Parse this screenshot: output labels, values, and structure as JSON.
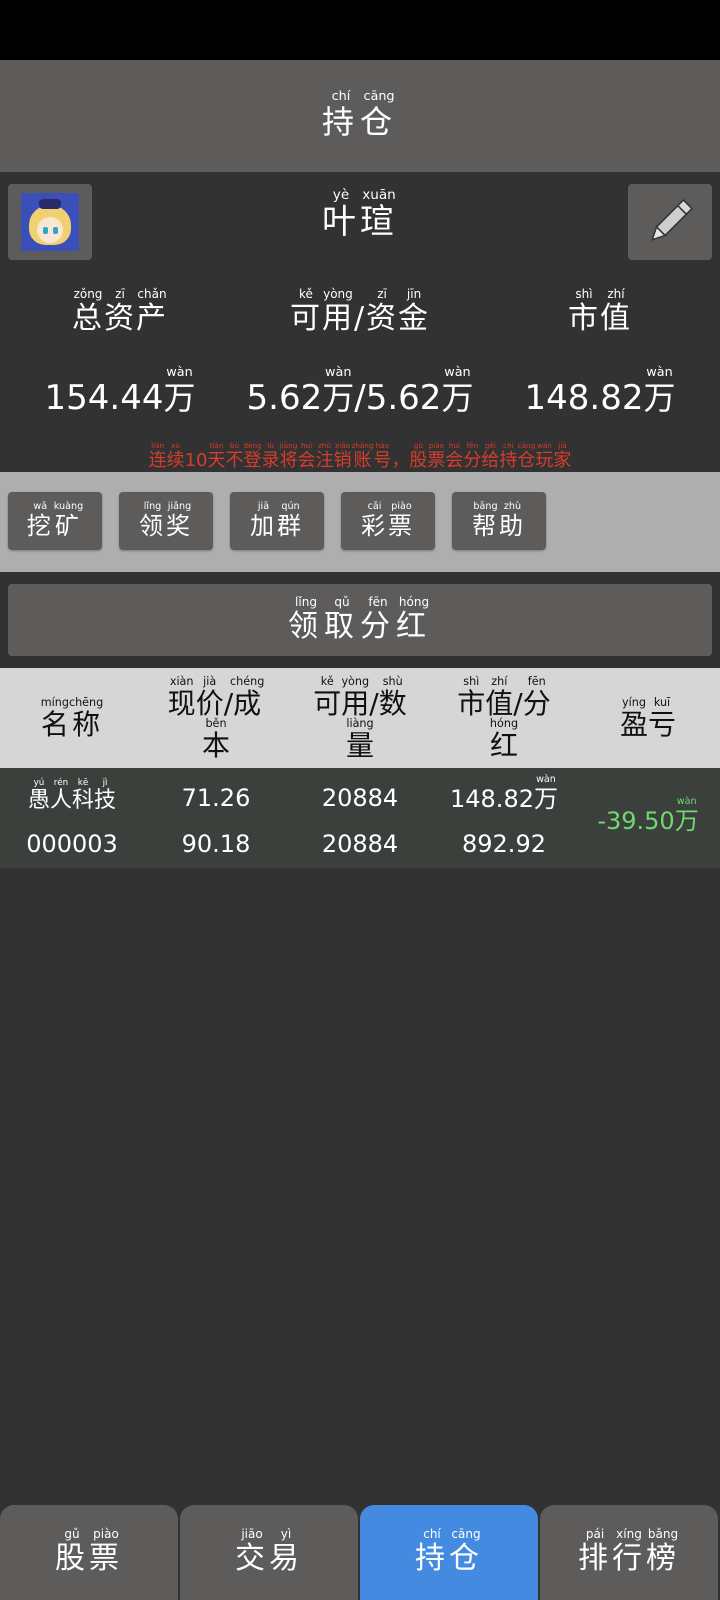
{
  "header": {
    "title": [
      [
        "持",
        "chí"
      ],
      [
        "仓",
        "cāng"
      ]
    ]
  },
  "profile": {
    "username": [
      [
        "叶",
        "yè"
      ],
      [
        "瑄",
        "xuān"
      ]
    ],
    "avatar_icon": "avatar-image",
    "edit_icon": "pencil-icon"
  },
  "stats": {
    "total_assets": {
      "label": [
        [
          "总",
          "zǒng"
        ],
        [
          "资",
          "zī"
        ],
        [
          "产",
          "chǎn"
        ]
      ],
      "value": "154.44",
      "unit": [
        [
          "万",
          "wàn"
        ]
      ]
    },
    "available_funds": {
      "label": [
        [
          "可",
          "kě"
        ],
        [
          "用",
          "yòng"
        ],
        [
          "/",
          ""
        ],
        [
          "资",
          "zī"
        ],
        [
          "金",
          "jīn"
        ]
      ],
      "value1": "5.62",
      "value2": "5.62",
      "separator": "/",
      "unit": [
        [
          "万",
          "wàn"
        ]
      ]
    },
    "market_value": {
      "label": [
        [
          "市",
          "shì"
        ],
        [
          "值",
          "zhí"
        ]
      ],
      "value": "148.82",
      "unit": [
        [
          "万",
          "wàn"
        ]
      ]
    }
  },
  "warning": [
    [
      "连",
      "lián"
    ],
    [
      "续",
      "xù"
    ],
    [
      "10",
      ""
    ],
    [
      "天",
      "tiān"
    ],
    [
      "不",
      "bù"
    ],
    [
      "登",
      "dēng"
    ],
    [
      "录",
      "lù"
    ],
    [
      "将",
      "jiāng"
    ],
    [
      "会",
      "huì"
    ],
    [
      "注",
      "zhù"
    ],
    [
      "销",
      "xiāo"
    ],
    [
      "账",
      "zhàng"
    ],
    [
      "号",
      "hào"
    ],
    [
      "，",
      ""
    ],
    [
      "股",
      "gǔ"
    ],
    [
      "票",
      "piào"
    ],
    [
      "会",
      "huì"
    ],
    [
      "分",
      "fēn"
    ],
    [
      "给",
      "gěi"
    ],
    [
      "持",
      "chí"
    ],
    [
      "仓",
      "cāng"
    ],
    [
      "玩",
      "wán"
    ],
    [
      "家",
      "jiā"
    ]
  ],
  "actions": [
    {
      "name": "mining-button",
      "label": [
        [
          "挖",
          "wā"
        ],
        [
          "矿",
          "kuàng"
        ]
      ]
    },
    {
      "name": "reward-button",
      "label": [
        [
          "领",
          "lǐng"
        ],
        [
          "奖",
          "jiǎng"
        ]
      ]
    },
    {
      "name": "join-group-button",
      "label": [
        [
          "加",
          "jiā"
        ],
        [
          "群",
          "qún"
        ]
      ]
    },
    {
      "name": "lottery-button",
      "label": [
        [
          "彩",
          "cǎi"
        ],
        [
          "票",
          "piào"
        ]
      ]
    },
    {
      "name": "help-button",
      "label": [
        [
          "帮",
          "bāng"
        ],
        [
          "助",
          "zhù"
        ]
      ]
    }
  ],
  "dividend_button": [
    [
      "领",
      "lǐng"
    ],
    [
      "取",
      "qǔ"
    ],
    [
      "分",
      "fēn"
    ],
    [
      "红",
      "hóng"
    ]
  ],
  "table": {
    "headers": {
      "name": [
        [
          "名",
          "míng"
        ],
        [
          "称",
          "chēng"
        ]
      ],
      "price_line1": [
        [
          "现",
          "xiàn"
        ],
        [
          "价",
          "jià"
        ],
        [
          "/",
          ""
        ],
        [
          "成",
          "chéng"
        ]
      ],
      "price_line2": [
        [
          "本",
          "běn"
        ]
      ],
      "qty_line1": [
        [
          "可",
          "kě"
        ],
        [
          "用",
          "yòng"
        ],
        [
          "/",
          ""
        ],
        [
          "数",
          "shù"
        ]
      ],
      "qty_line2": [
        [
          "量",
          "liàng"
        ]
      ],
      "mv_line1": [
        [
          "市",
          "shì"
        ],
        [
          "值",
          "zhí"
        ],
        [
          "/",
          ""
        ],
        [
          "分",
          "fēn"
        ]
      ],
      "mv_line2": [
        [
          "红",
          "hóng"
        ]
      ],
      "pnl": [
        [
          "盈",
          "yíng"
        ],
        [
          "亏",
          "kuī"
        ]
      ]
    },
    "rows": [
      {
        "name": [
          [
            "愚",
            "yú"
          ],
          [
            "人",
            "rén"
          ],
          [
            "科",
            "kē"
          ],
          [
            "技",
            "jì"
          ]
        ],
        "code": "000003",
        "price": "71.26",
        "cost": "90.18",
        "available": "20884",
        "quantity": "20884",
        "market_value": "148.82",
        "market_value_unit": [
          [
            "万",
            "wàn"
          ]
        ],
        "dividend": "892.92",
        "pnl": "-39.50",
        "pnl_unit": [
          [
            "万",
            "wàn"
          ]
        ]
      }
    ]
  },
  "nav": [
    {
      "name": "nav-stocks",
      "label": [
        [
          "股",
          "gǔ"
        ],
        [
          "票",
          "piào"
        ]
      ],
      "active": false
    },
    {
      "name": "nav-trade",
      "label": [
        [
          "交",
          "jiāo"
        ],
        [
          "易",
          "yì"
        ]
      ],
      "active": false
    },
    {
      "name": "nav-holdings",
      "label": [
        [
          "持",
          "chí"
        ],
        [
          "仓",
          "cāng"
        ]
      ],
      "active": true
    },
    {
      "name": "nav-ranking",
      "label": [
        [
          "排",
          "pái"
        ],
        [
          "行",
          "xíng"
        ],
        [
          "榜",
          "bǎng"
        ]
      ],
      "active": false
    }
  ],
  "colors": {
    "active_tab": "#438ae0",
    "warning_text": "#d83c2c",
    "pnl_text": "#6fd86f"
  }
}
